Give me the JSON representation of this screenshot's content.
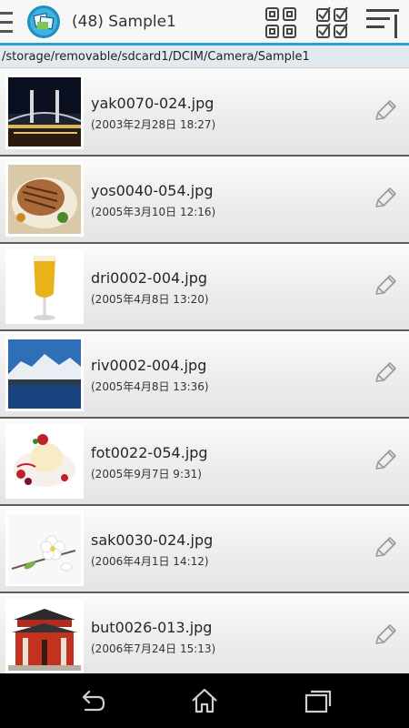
{
  "header": {
    "title": "(48) Sample1",
    "icons": [
      "menu-icon",
      "app-logo-icon",
      "grid-view-icon",
      "select-all-icon",
      "sort-menu-icon"
    ]
  },
  "path": "/storage/removable/sdcard1/DCIM/Camera/Sample1",
  "files": [
    {
      "name": "yak0070-024.jpg",
      "date": "(2003年2月28日 18:27)"
    },
    {
      "name": "yos0040-054.jpg",
      "date": "(2005年3月10日 12:16)"
    },
    {
      "name": "dri0002-004.jpg",
      "date": "(2005年4月8日 13:20)"
    },
    {
      "name": "riv0002-004.jpg",
      "date": "(2005年4月8日 13:36)"
    },
    {
      "name": "fot0022-054.jpg",
      "date": "(2005年9月7日 9:31)"
    },
    {
      "name": "sak0030-024.jpg",
      "date": "(2006年4月1日 14:12)"
    },
    {
      "name": "but0026-013.jpg",
      "date": "(2006年7月24日 15:13)"
    }
  ],
  "navbar": {
    "icons": [
      "back-icon",
      "home-icon",
      "recent-apps-icon"
    ]
  },
  "colors": {
    "accent": "#29a3d6",
    "row_separator": "#5b5b5b",
    "nav_background": "#000000"
  }
}
